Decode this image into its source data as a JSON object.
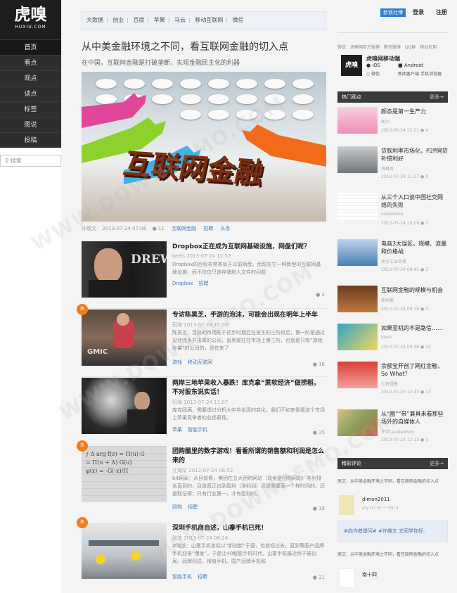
{
  "logo": {
    "name": "虎嗅",
    "sub": "HUXIU.COM"
  },
  "nav": [
    "首页",
    "看点",
    "观点",
    "读点",
    "标签",
    "图说",
    "投稿"
  ],
  "search": {
    "placeholder": "搜索"
  },
  "topnav": [
    "大数据",
    "创业",
    "百度",
    "苹果",
    "马云",
    "移动互联网",
    "微信"
  ],
  "article": {
    "title": "从中美金融环境之不同，看互联网金融的切入点",
    "subtitle": "在中国，互联网金融是打破垄断，实现金融民主化的利器",
    "hero_text": "互联网金融",
    "meta_author": "许维文",
    "meta_date": "2013-07-24 07:06",
    "meta_count": "11",
    "tags": [
      "互联网金融",
      "招聘",
      "头条"
    ]
  },
  "list": [
    {
      "title": "Dropbox正在成为互联网基础设施，网盘们呢？",
      "author": "keels",
      "date": "2013-07-24 12:52",
      "excerpt": "Dropbox的目标非常类似于以前网盘，而现在它一种新型的互联网基础设施，而不仅仅只是存储和人文件的问题",
      "tags": [
        "Dropbox",
        "招聘"
      ],
      "count": "2",
      "hot": false,
      "thumb": "DREW"
    },
    {
      "title": "专访陈昊芝，手游的泡沫，可能会出现在明年上半年",
      "author": "田海",
      "date": "2013-07-24 12:00",
      "excerpt": "陈昊芝：目前的市场处于初步时期后在发生的三阶段后，第一阶是通过设计流水并出来的公司，直到现在在市场上第三阶，也就是只有“游戏存量”的公司的，现在来了",
      "tags": [
        "游戏",
        "移动互联网"
      ],
      "count": "16",
      "hot": true,
      "thumb": "GMIC"
    },
    {
      "title": "两岸三地苹果收入暴跌！库克拿“蔗软经济”做捞稻，不对股东说实话！",
      "author": "田海",
      "date": "2013-07-24 11:07",
      "excerpt": "库克园满，需要透过分析大中华出现的变化，我们不如来看看这个市场上苹果竞争者的业绩表现。",
      "tags": [
        "苹果",
        "智能手机"
      ],
      "count": "25",
      "hot": false,
      "thumb": ""
    },
    {
      "title": "团购圈里的数字游戏！看看所谓的销售额和利润是怎么来的",
      "author": "江湖朵",
      "date": "2013-07-24 06:52",
      "excerpt": "bit网朵：从目前看，美团在五大团购网站（现金是团购网站）名列排名直到的，且是真正出到盈利（净利润）还是需要面一个样时间的，还是取记得：只有行业第一，才有盈利的。",
      "tags": [
        "团购",
        "招聘"
      ],
      "count": "19",
      "hot": true,
      "thumb": ""
    },
    {
      "title": "深圳手机商自述，山寨手机已死！",
      "author": "晓芝",
      "date": "2013-07-24 06:24",
      "excerpt": "#晓芝：山寨手机曾经以“新创新”于国，也曾经过去，直到等国产品牌手机迎来“爆发”，于是让40智能手机时代，山寨手机最近终于被出局。品牌迎送、增值手机、国产品牌手机和",
      "tags": [
        "智能手机",
        "招聘"
      ],
      "count": "21",
      "hot": true,
      "thumb": ""
    }
  ],
  "right": {
    "follow": "新浪社博",
    "login": "登录",
    "register": "注册",
    "social": [
      "微信",
      "虎嗅网官方微博",
      "腾讯微博",
      "QQ群",
      "移动应用"
    ],
    "app": {
      "title": "虎嗅网移动端",
      "ios": "iOS",
      "android": "Android",
      "wechat": "微信",
      "news": "新闻客户端",
      "mobile": "手机浏览器"
    },
    "hot_header": "热门观点",
    "more": "更多→",
    "hot": [
      {
        "title": "颜态是第一生产力",
        "sub": "闻川",
        "date": "2013-07-24 12:21",
        "count": "4"
      },
      {
        "title": "贷款利率市场化，P2P网贷补偿利好",
        "sub": "钱峰风",
        "date": "2013-07-24 11:37",
        "count": "0"
      },
      {
        "title": "从三个入口谈中国社交网络的失败",
        "sub": "Leslewhoo",
        "date": "2013-07-24 10:29",
        "count": "3"
      },
      {
        "title": "电商3大误区，规模、流量和价格战",
        "sub": "虎子工业世界",
        "date": "2013-07-24 09:45",
        "count": "2"
      },
      {
        "title": "互联网金融的规模与机会",
        "sub": "新闻报",
        "date": "2013-07-24 09:18",
        "count": "0"
      },
      {
        "title": "如果亚机的不是路信……",
        "sub": "keels",
        "date": "2013-07-24 09:36",
        "count": "12"
      },
      {
        "title": "余额宝开创了网红金融，So What？",
        "sub": "汇致得墨",
        "date": "2013-07-23 12:43",
        "count": "13"
      },
      {
        "title": "从“圈”“带”兼具未看那些场外的自媒体人",
        "sub": "王学Leeslewhoo",
        "date": "2013-07-23 12:13",
        "count": "3"
      }
    ],
    "comment_header": "精彩评论",
    "comment_source": "原文：从中美金融环境之不同，看互联网金融的切入点",
    "comment_user": "dimon2011",
    "comment_date": "ary 07 日 一 09 :1",
    "comment_text": "#向作者提问# #许维文  文同学你好,",
    "comment_source2": "原文：从中美金融环境之不同，看互联网金融的切入点",
    "comment_user2": "南十四"
  }
}
